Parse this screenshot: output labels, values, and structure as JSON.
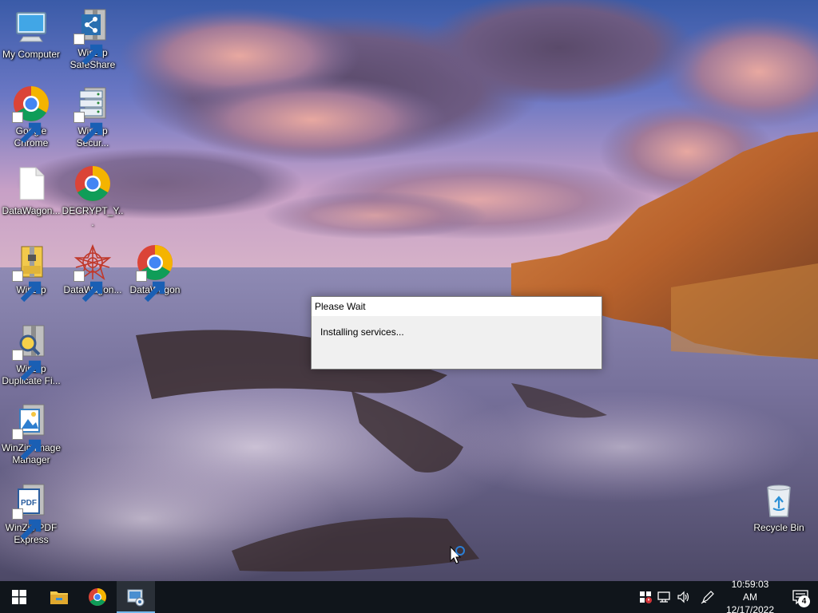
{
  "desktop": {
    "icons": [
      {
        "label": "My Computer",
        "icon": "computer-icon"
      },
      {
        "label": "WinZip SafeShare",
        "icon": "winzip-safeshare-icon"
      },
      {
        "label": "Google Chrome",
        "icon": "chrome-icon"
      },
      {
        "label": "WinZip Secur...",
        "icon": "winzip-secure-backup-icon"
      },
      {
        "label": "DataWagon...",
        "icon": "blank-file-icon"
      },
      {
        "label": "DECRYPT_Y...",
        "icon": "chrome-icon"
      },
      {
        "label": "WinZip",
        "icon": "winzip-icon"
      },
      {
        "label": "DataWagon...",
        "icon": "datawagon-star-icon"
      },
      {
        "label": "DataWagon",
        "icon": "chrome-icon"
      },
      {
        "label": "WinZip Duplicate Fi...",
        "icon": "winzip-duplicate-finder-icon"
      },
      {
        "label": "WinZip Image Manager",
        "icon": "winzip-image-manager-icon"
      },
      {
        "label": "WinZip PDF Express",
        "icon": "winzip-pdf-icon"
      },
      {
        "label": "Recycle Bin",
        "icon": "recycle-bin-icon"
      }
    ]
  },
  "dialog": {
    "title": "Please Wait",
    "message": "Installing services..."
  },
  "taskbar": {
    "start": "windows-start-icon",
    "pinned": [
      "file-explorer-icon",
      "chrome-icon",
      "installer-icon"
    ],
    "tray": [
      "security-shield-icon",
      "network-icon",
      "volume-icon",
      "pen-icon"
    ],
    "time": "10:59:03 AM",
    "date": "12/17/2022",
    "notifications": "4"
  },
  "colors": {
    "taskbar": "#10151b",
    "accent": "#76b9ed",
    "dialog_bg": "#f0f0f0"
  }
}
